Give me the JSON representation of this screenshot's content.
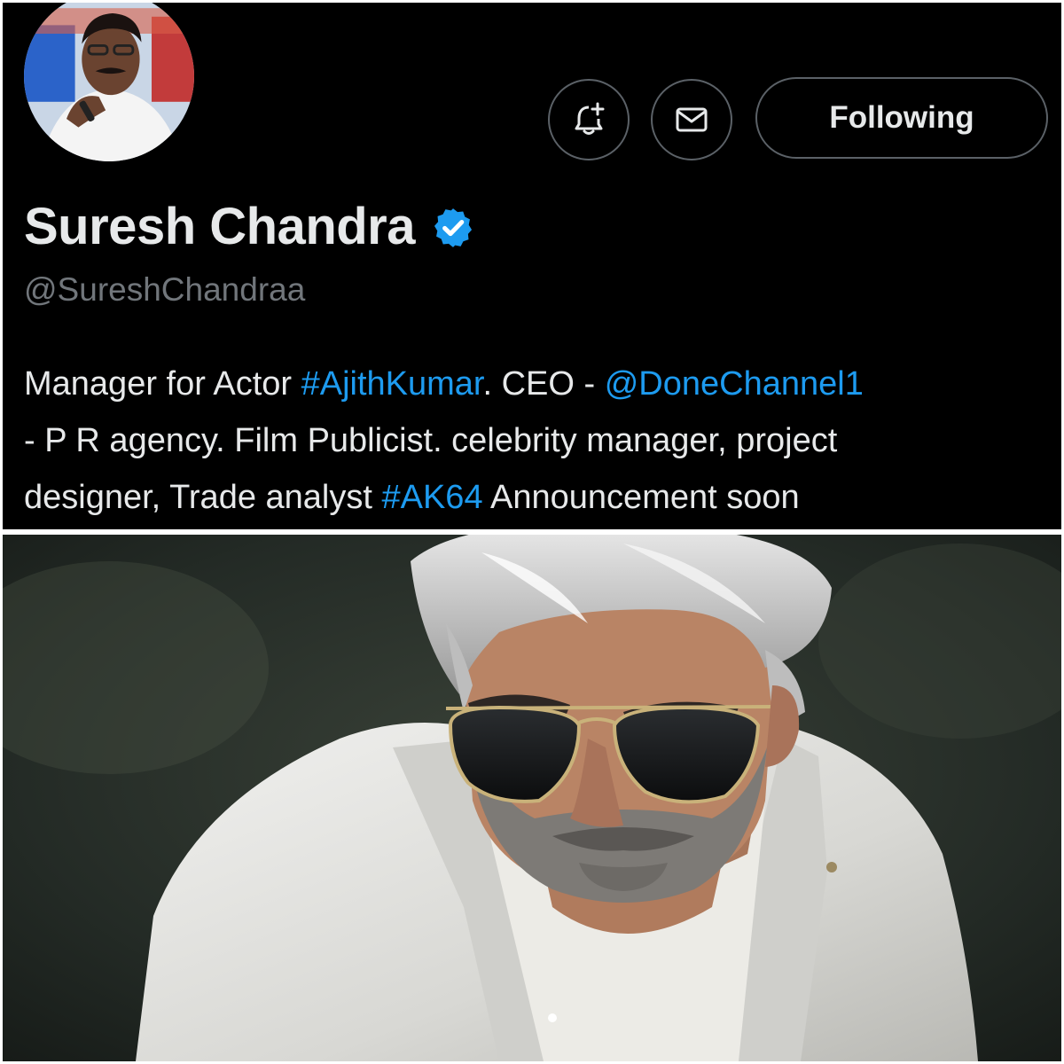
{
  "profile": {
    "display_name": "Suresh Chandra",
    "handle": "@SureshChandraa",
    "verified": true,
    "avatar_icon": "avatar-photo",
    "buttons": {
      "notify_icon": "bell-plus-icon",
      "message_icon": "envelope-icon",
      "following_label": "Following"
    },
    "bio": {
      "line1": {
        "t1": "Manager for Actor ",
        "hashtag1": "#AjithKumar",
        "t2": ". CEO - ",
        "mention1": "@DoneChannel1"
      },
      "line2": "- P R agency. Film Publicist. celebrity manager, project",
      "line3": {
        "t1": "designer, Trade analyst ",
        "hashtag2": "#AK64",
        "t2": " Announcement soon"
      }
    }
  },
  "colors": {
    "background": "#000000",
    "text_primary": "#e7e9ea",
    "text_secondary": "#71767b",
    "link": "#1d9bf0",
    "button_border": "#5b6167",
    "verified_badge": "#1d9bf0"
  },
  "photo": {
    "subject": "man-in-white-suit-with-aviator-sunglasses"
  }
}
